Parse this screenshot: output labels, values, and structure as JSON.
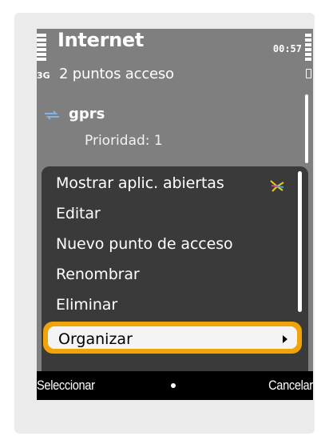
{
  "header": {
    "title": "Internet",
    "time": "00:57",
    "network": "3G",
    "subtitle": "2 puntos acceso"
  },
  "access_point": {
    "name": "gprs",
    "priority": "Prioridad: 1",
    "icon": "arrows-icon"
  },
  "menu": {
    "items": [
      "Mostrar aplic. abiertas",
      "Editar",
      "Nuevo punto de acceso",
      "Renombrar",
      "Eliminar"
    ],
    "selected": "Organizar",
    "selected_color": "#f0a40a"
  },
  "softkeys": {
    "left": "Seleccionar",
    "right": "Cancelar"
  }
}
